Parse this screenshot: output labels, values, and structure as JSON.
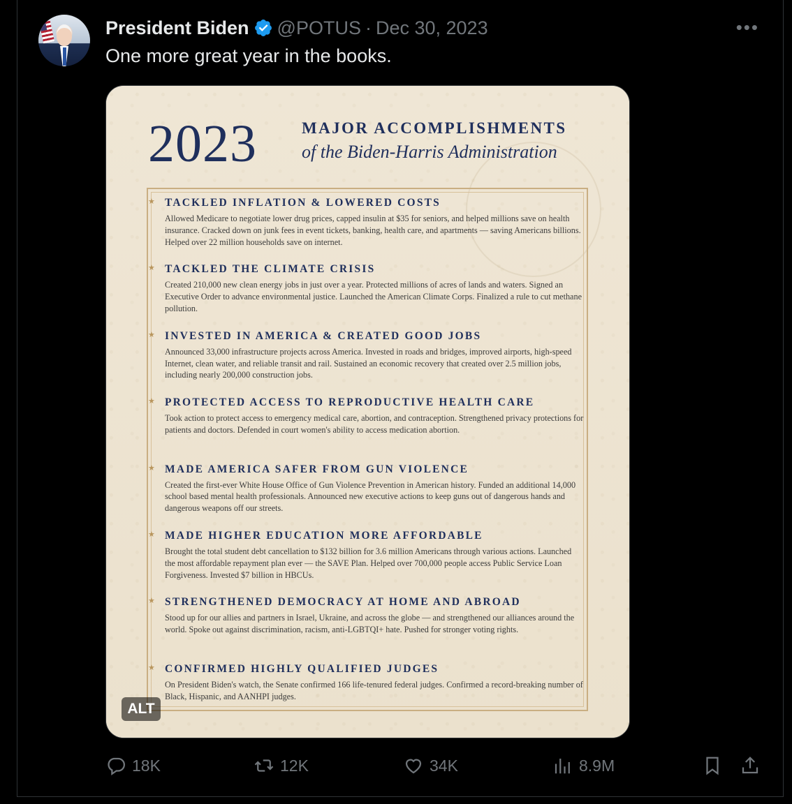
{
  "tweet": {
    "author_name": "President Biden",
    "handle": "@POTUS",
    "separator": "·",
    "date": "Dec 30, 2023",
    "more_label": "•••",
    "text": "One more great year in the books."
  },
  "image": {
    "year": "2023",
    "heading": "MAJOR ACCOMPLISHMENTS",
    "subheading": "of the Biden-Harris Administration",
    "alt_badge": "ALT",
    "items": [
      {
        "title": "TACKLED INFLATION & LOWERED COSTS",
        "body": "Allowed Medicare to negotiate lower drug prices, capped insulin at $35 for seniors, and helped millions save on health insurance. Cracked down on junk fees in event tickets, banking, health care, and apartments — saving Americans billions. Helped over 22 million households save on internet."
      },
      {
        "title": "TACKLED THE CLIMATE CRISIS",
        "body": "Created 210,000 new clean energy jobs in just over a year. Protected millions of acres of lands and waters. Signed an Executive Order to advance environmental justice. Launched the American Climate Corps. Finalized a rule to cut methane pollution."
      },
      {
        "title": "INVESTED IN AMERICA & CREATED GOOD JOBS",
        "body": "Announced 33,000 infrastructure projects across America. Invested in roads and bridges, improved airports, high-speed Internet, clean water, and reliable transit and rail. Sustained an economic recovery that created over 2.5 million jobs, including nearly 200,000 construction jobs."
      },
      {
        "title": "PROTECTED ACCESS TO REPRODUCTIVE HEALTH CARE",
        "body": "Took action to protect access to emergency medical care, abortion, and contraception. Strengthened privacy protections for patients and doctors. Defended in court women's ability to access medication abortion."
      },
      {
        "title": "MADE AMERICA SAFER FROM GUN VIOLENCE",
        "body": "Created the first-ever White House Office of Gun Violence Prevention in American history. Funded an additional 14,000 school based mental health professionals. Announced new executive actions to keep guns out of dangerous hands and dangerous weapons off our streets."
      },
      {
        "title": "MADE HIGHER EDUCATION MORE AFFORDABLE",
        "body": "Brought the total student debt cancellation to $132 billion for 3.6 million Americans through various actions. Launched the most affordable repayment plan ever — the SAVE Plan. Helped over 700,000 people access Public Service Loan Forgiveness. Invested $7 billion in HBCUs."
      },
      {
        "title": "STRENGTHENED DEMOCRACY AT HOME AND ABROAD",
        "body": "Stood up for our allies and partners in Israel, Ukraine, and across the globe — and strengthened our alliances around the world. Spoke out against discrimination, racism, anti-LGBTQI+ hate. Pushed for stronger voting rights."
      },
      {
        "title": "CONFIRMED HIGHLY QUALIFIED JUDGES",
        "body": "On President Biden's watch, the Senate confirmed 166 life-tenured federal judges. Confirmed a record-breaking number of Black, Hispanic, and AANHPI judges."
      }
    ]
  },
  "actions": {
    "replies": "18K",
    "reposts": "12K",
    "likes": "34K",
    "views": "8.9M"
  },
  "icons": {
    "reply": "reply-icon",
    "repost": "repost-icon",
    "like": "heart-icon",
    "views": "views-icon",
    "bookmark": "bookmark-icon",
    "share": "share-icon",
    "verified": "verified-badge-icon",
    "more": "more-icon"
  },
  "colors": {
    "background": "#000000",
    "text": "#e7e9ea",
    "muted": "#71767b",
    "verified": "#1d9bf0",
    "navy": "#1f2f5c",
    "paper": "#ede4d2"
  }
}
